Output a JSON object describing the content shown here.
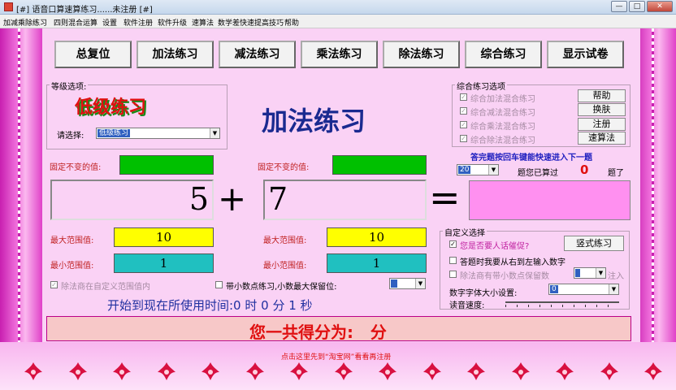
{
  "window": {
    "title": "[#] 语音口算速算练习......未注册 [#]"
  },
  "menu": [
    "加减乘除练习",
    "四则混合运算",
    "设置",
    "软件注册",
    "软件升级",
    "速算法",
    "数学差快速提高技巧",
    "帮助"
  ],
  "toolbar": [
    "总复位",
    "加法练习",
    "减法练习",
    "乘法练习",
    "除法练习",
    "综合练习",
    "显示试卷"
  ],
  "level": {
    "group_title": "等级选项:",
    "banner": "低级练习",
    "select_label": "请选择:",
    "select_value": "低级练习"
  },
  "mode_title": "加法练习",
  "combined": {
    "group_title": "综合练习选项",
    "options": [
      "综合加法混合练习",
      "综合减法混合练习",
      "综合乘法混合练习",
      "综合除法混合练习"
    ],
    "buttons": [
      "帮助",
      "换肤",
      "注册",
      "速算法"
    ]
  },
  "hint": "答完题按回车键能快速进入下一题",
  "progress": {
    "count_value": "20",
    "text1": "题您已算过",
    "done": "0",
    "text2": "题了"
  },
  "fixed_left_label": "固定不变的值:",
  "fixed_right_label": "固定不变的值:",
  "equation": {
    "a": "5",
    "op": "+",
    "b": "7",
    "eq": "="
  },
  "left_range": {
    "max_label": "最大范围值:",
    "max": "10",
    "min_label": "最小范围值:",
    "min": "1"
  },
  "right_range": {
    "max_label": "最大范围值:",
    "max": "10",
    "min_label": "最小范围值:",
    "min": "1"
  },
  "divide_option": "除法商在自定义范围值内",
  "decimal_option": "带小数点练习,小数最大保留位:",
  "custom": {
    "group_title": "自定义选择",
    "opt1": "您是否要人话催促?",
    "vertical_btn": "竖式练习",
    "opt2": "答题时我要从右到左输入数字",
    "opt3": "除法商有带小数点保留数",
    "opt3_suffix": "注入",
    "font_label": "数字字体大小设置:",
    "font_value": "0",
    "speed_label": "读音速度:"
  },
  "timer": "开始到现在所使用时间:0 时 0 分 1 秒",
  "score": "您一共得分为:   分",
  "footer_link": "点击这里先到“淘宝网”看看再注册",
  "colors": {
    "green": "#00c000",
    "yellow": "#ffff00",
    "teal": "#20c0c0",
    "answer": "#ff90f0",
    "score_bg": "#f7c8c8",
    "accent_blue": "#2030a0"
  }
}
